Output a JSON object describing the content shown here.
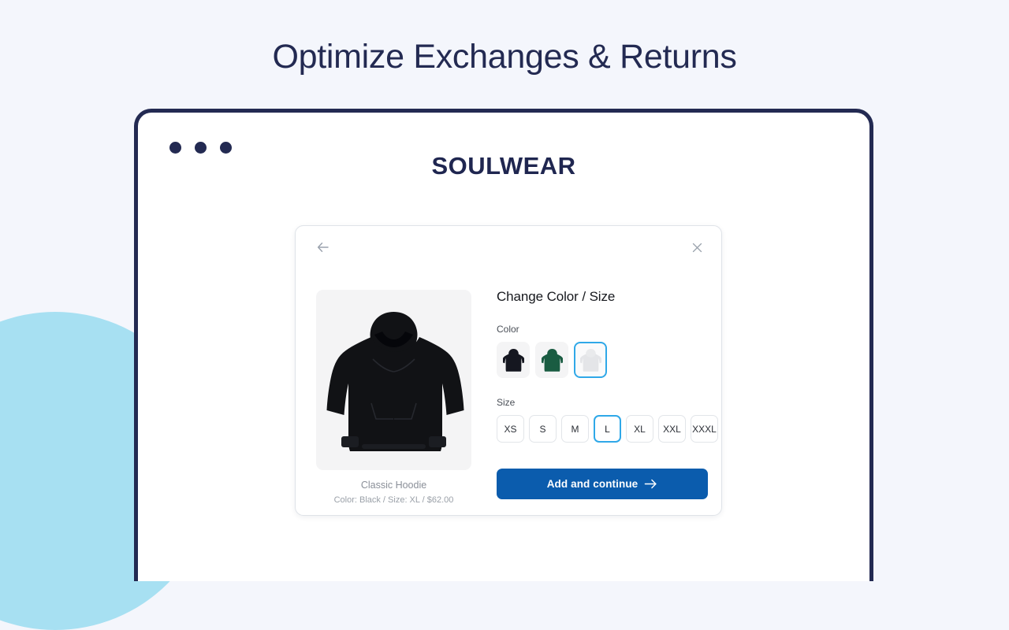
{
  "page": {
    "title": "Optimize Exchanges & Returns",
    "background_color": "#f4f6fc",
    "accent_color": "#2fa8e8",
    "navy_color": "#232a52",
    "decoration": "light-blue-circle"
  },
  "browser": {
    "dots_count": 3,
    "dot_color": "#232a52",
    "brand": "SOULWEAR"
  },
  "modal": {
    "back_icon": "arrow-left-icon",
    "close_icon": "close-icon",
    "heading": "Change Color / Size",
    "color_label": "Color",
    "size_label": "Size",
    "colors": [
      {
        "name": "Black",
        "hex": "#151720",
        "selected": false
      },
      {
        "name": "Green",
        "hex": "#1a5c42",
        "selected": false
      },
      {
        "name": "White",
        "hex": "#e9eaec",
        "selected": true
      }
    ],
    "sizes": [
      {
        "label": "XS",
        "selected": false
      },
      {
        "label": "S",
        "selected": false
      },
      {
        "label": "M",
        "selected": false
      },
      {
        "label": "L",
        "selected": true
      },
      {
        "label": "XL",
        "selected": false
      },
      {
        "label": "XXL",
        "selected": false
      },
      {
        "label": "XXXL",
        "selected": false
      }
    ],
    "cta_label": "Add and continue",
    "cta_icon": "arrow-right-icon",
    "cta_color": "#0b5cad"
  },
  "product": {
    "name": "Classic Hoodie",
    "meta": "Color: Black / Size: XL / $62.00",
    "color": "Black",
    "size": "XL",
    "price": "$62.00",
    "image_alt": "black-hoodie"
  }
}
